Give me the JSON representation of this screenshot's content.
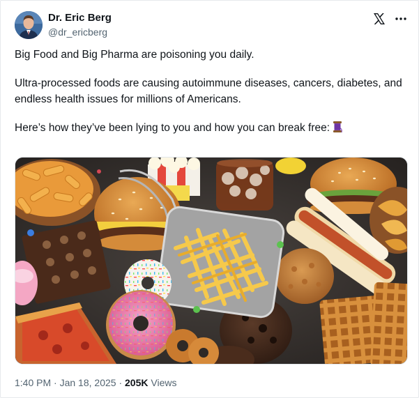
{
  "author": {
    "display_name": "Dr. Eric Berg",
    "handle": "@dr_ericberg",
    "avatar_icon": "profile-photo"
  },
  "icons": {
    "logo": "x-logo-icon",
    "more": "more-options-icon",
    "emoji": "thread-spool-emoji"
  },
  "post": {
    "paragraph_1": "Big Food and Big Pharma are poisoning you daily.",
    "paragraph_2": "Ultra-processed foods are causing autoimmune diseases, cancers, diabetes, and endless health issues for millions of Americans.",
    "paragraph_3": "Here’s how they’ve been lying to you and how you can break free:"
  },
  "meta": {
    "time": "1:40 PM",
    "separator_1": "·",
    "date": "Jan 18, 2025",
    "separator_2": "·",
    "views_count": "205K",
    "views_label": "Views"
  },
  "colors": {
    "text_primary": "#0f1419",
    "text_secondary": "#536471",
    "border": "#e6e9ec"
  }
}
